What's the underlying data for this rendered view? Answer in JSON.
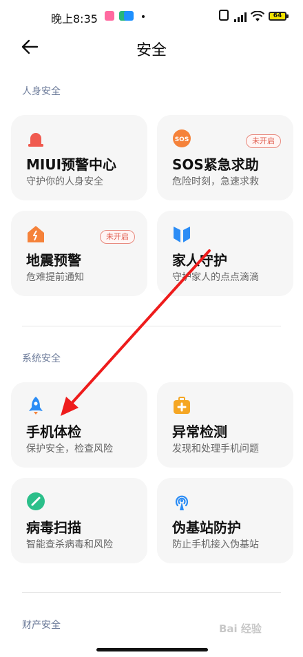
{
  "status": {
    "time": "晚上8:35",
    "battery": "64"
  },
  "header": {
    "title": "安全"
  },
  "sections": [
    {
      "title": "人身安全",
      "cards": [
        {
          "title": "MIUI预警中心",
          "subtitle": "守护你的人身安全",
          "icon": "alarm-siren-icon",
          "color": "#f05a4f",
          "badge": ""
        },
        {
          "title": "SOS紧急求助",
          "subtitle": "危险时刻，急速求救",
          "icon": "sos-icon",
          "color": "#f5823a",
          "badge": "未开启"
        },
        {
          "title": "地震预警",
          "subtitle": "危难提前通知",
          "icon": "earthquake-house-icon",
          "color": "#f5823a",
          "badge": "未开启"
        },
        {
          "title": "家人守护",
          "subtitle": "守护家人的点点滴滴",
          "icon": "family-shield-icon",
          "color": "#2b8cf5",
          "badge": ""
        }
      ]
    },
    {
      "title": "系统安全",
      "cards": [
        {
          "title": "手机体检",
          "subtitle": "保护安全，检查风险",
          "icon": "rocket-icon",
          "color": "#2b8cf5",
          "badge": ""
        },
        {
          "title": "异常检测",
          "subtitle": "发现和处理手机问题",
          "icon": "first-aid-kit-icon",
          "color": "#f5a623",
          "badge": ""
        },
        {
          "title": "病毒扫描",
          "subtitle": "智能查杀病毒和风险",
          "icon": "virus-scan-icon",
          "color": "#2bbf8a",
          "badge": ""
        },
        {
          "title": "伪基站防护",
          "subtitle": "防止手机接入伪基站",
          "icon": "signal-tower-icon",
          "color": "#2b8cf5",
          "badge": ""
        }
      ]
    },
    {
      "title": "财产安全",
      "cards": []
    }
  ],
  "watermark": "Bai 经验"
}
